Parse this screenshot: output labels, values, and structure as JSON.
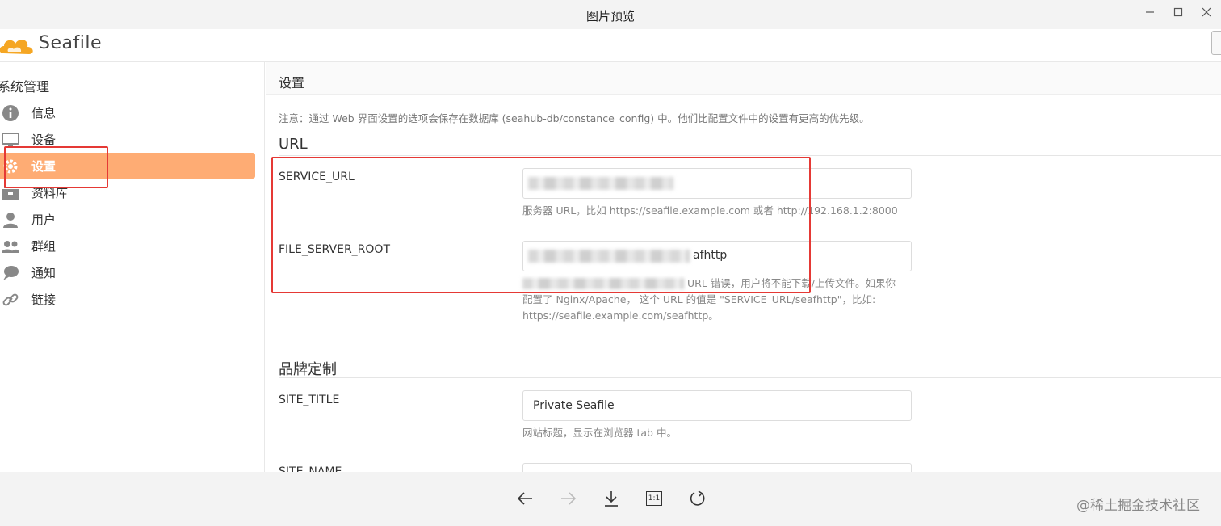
{
  "window": {
    "title": "图片预览"
  },
  "app": {
    "logo_text": "Seafile"
  },
  "sidebar": {
    "heading": "系统管理",
    "items": [
      {
        "label": "信息",
        "icon": "info-icon"
      },
      {
        "label": "设备",
        "icon": "monitor-icon"
      },
      {
        "label": "设置",
        "icon": "gear-icon",
        "active": true
      },
      {
        "label": "资料库",
        "icon": "library-icon"
      },
      {
        "label": "用户",
        "icon": "user-icon"
      },
      {
        "label": "群组",
        "icon": "group-icon"
      },
      {
        "label": "通知",
        "icon": "chat-icon"
      },
      {
        "label": "链接",
        "icon": "link-icon"
      }
    ]
  },
  "main": {
    "page_title": "设置",
    "note": "注意：通过 Web 界面设置的选项会保存在数据库 (seahub-db/constance_config) 中。他们比配置文件中的设置有更高的优先级。",
    "sections": {
      "url": {
        "title": "URL",
        "service_url": {
          "label": "SERVICE_URL",
          "help": "服务器 URL，比如 https://seafile.example.com 或者 http://192.168.1.2:8000"
        },
        "file_server_root": {
          "label": "FILE_SERVER_ROOT",
          "value_suffix": "afhttp",
          "help_line1": "URL 错误，用户将不能下载/上传文件。如果你",
          "help_line2": "配置了 Nginx/Apache， 这个 URL 的值是 \"SERVICE_URL/seafhttp\"，比如:",
          "help_line3": "https://seafile.example.com/seafhttp。"
        }
      },
      "branding": {
        "title": "品牌定制",
        "site_title": {
          "label": "SITE_TITLE",
          "value": "Private Seafile",
          "help": "网站标题，显示在浏览器 tab 中。"
        },
        "site_name": {
          "label": "SITE_NAME"
        }
      }
    }
  },
  "toolbar": {
    "buttons": [
      "back-arrow-icon",
      "forward-arrow-icon",
      "download-icon",
      "actual-size-icon",
      "rotate-icon"
    ],
    "actual_size_label": "1:1"
  },
  "watermark": "@稀土掘金技术社区",
  "colors": {
    "accent": "#feac74",
    "highlight_box": "#e53935",
    "logo_orange": "#f5a623"
  }
}
